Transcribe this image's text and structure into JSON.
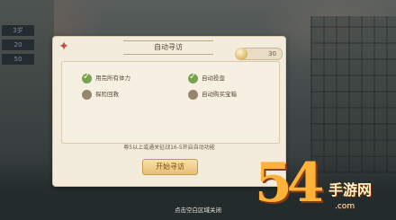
{
  "dialog": {
    "title": "自动寻访",
    "counter_value": "30",
    "options": [
      {
        "label": "用完所有体力",
        "checked": true
      },
      {
        "label": "自动投壶",
        "checked": true
      },
      {
        "label": "探险回救",
        "checked": false
      },
      {
        "label": "自动购买宝箱",
        "checked": false
      }
    ],
    "hint": "尊5以上或通关征战16-5开启自动功能",
    "start_button": "开始寻访"
  },
  "close_hint": "点击空白区域关闭",
  "side_tiles": [
    "3岁",
    "20",
    "50"
  ],
  "watermark": {
    "logo": "54",
    "text": "手游网",
    "url": ".com"
  },
  "colors": {
    "accent_check": "#7aa14e",
    "button_fill": "#e6bf73",
    "dialog_bg": "#f3ecdc"
  }
}
